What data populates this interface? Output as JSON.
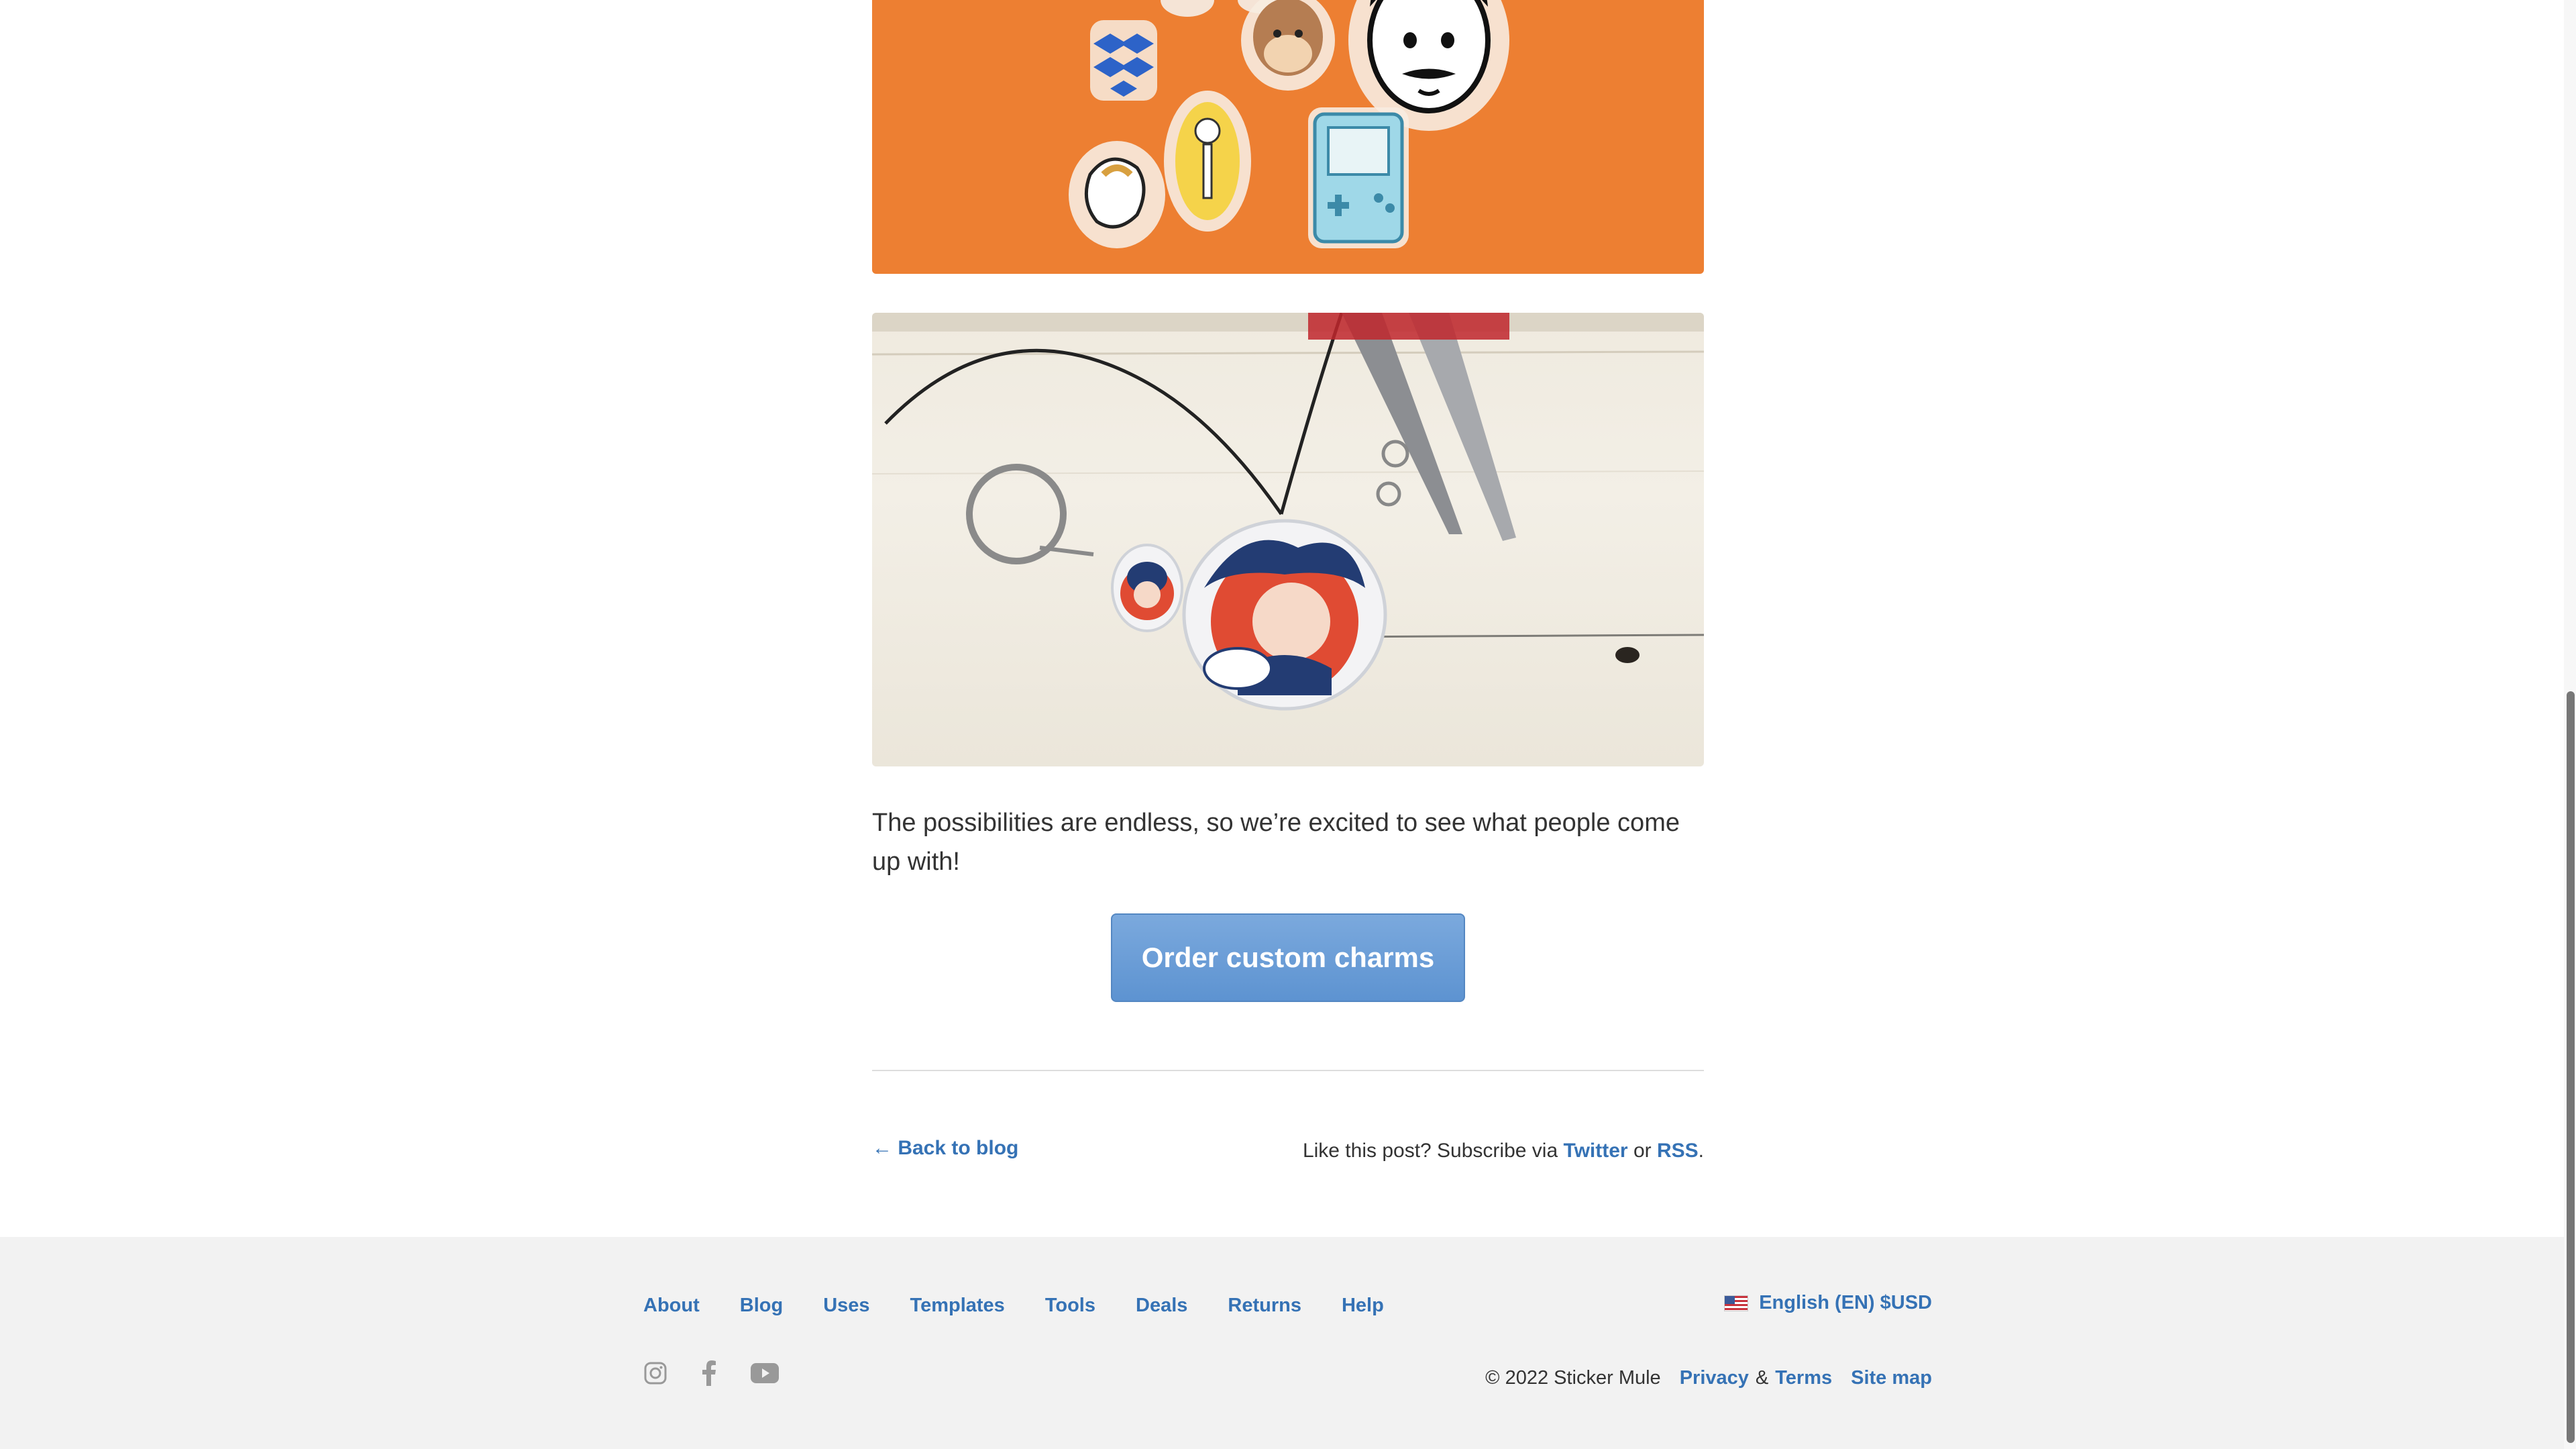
{
  "article": {
    "body_text": "The possibilities are endless, so we’re excited to see what people come up with!",
    "cta_label": "Order custom charms",
    "back_label": "← Back to blog",
    "subscribe_prefix": "Like this post? Subscribe via",
    "subscribe_twitter": "Twitter",
    "subscribe_or": "or",
    "subscribe_rss": "RSS",
    "subscribe_suffix": "."
  },
  "footer": {
    "nav": [
      "About",
      "Blog",
      "Uses",
      "Templates",
      "Tools",
      "Deals",
      "Returns",
      "Help"
    ],
    "language": "English (EN) $USD",
    "copyright": "© 2022 Sticker Mule",
    "privacy": "Privacy",
    "amp": "&",
    "terms": "Terms",
    "sitemap": "Site map",
    "social_icons": [
      "instagram-icon",
      "facebook-icon",
      "youtube-icon"
    ]
  },
  "colors": {
    "link": "#3572b5",
    "cta": "#6b9fd8",
    "orange_image": "#ed7f32",
    "footer_bg": "#f2f2f2"
  }
}
